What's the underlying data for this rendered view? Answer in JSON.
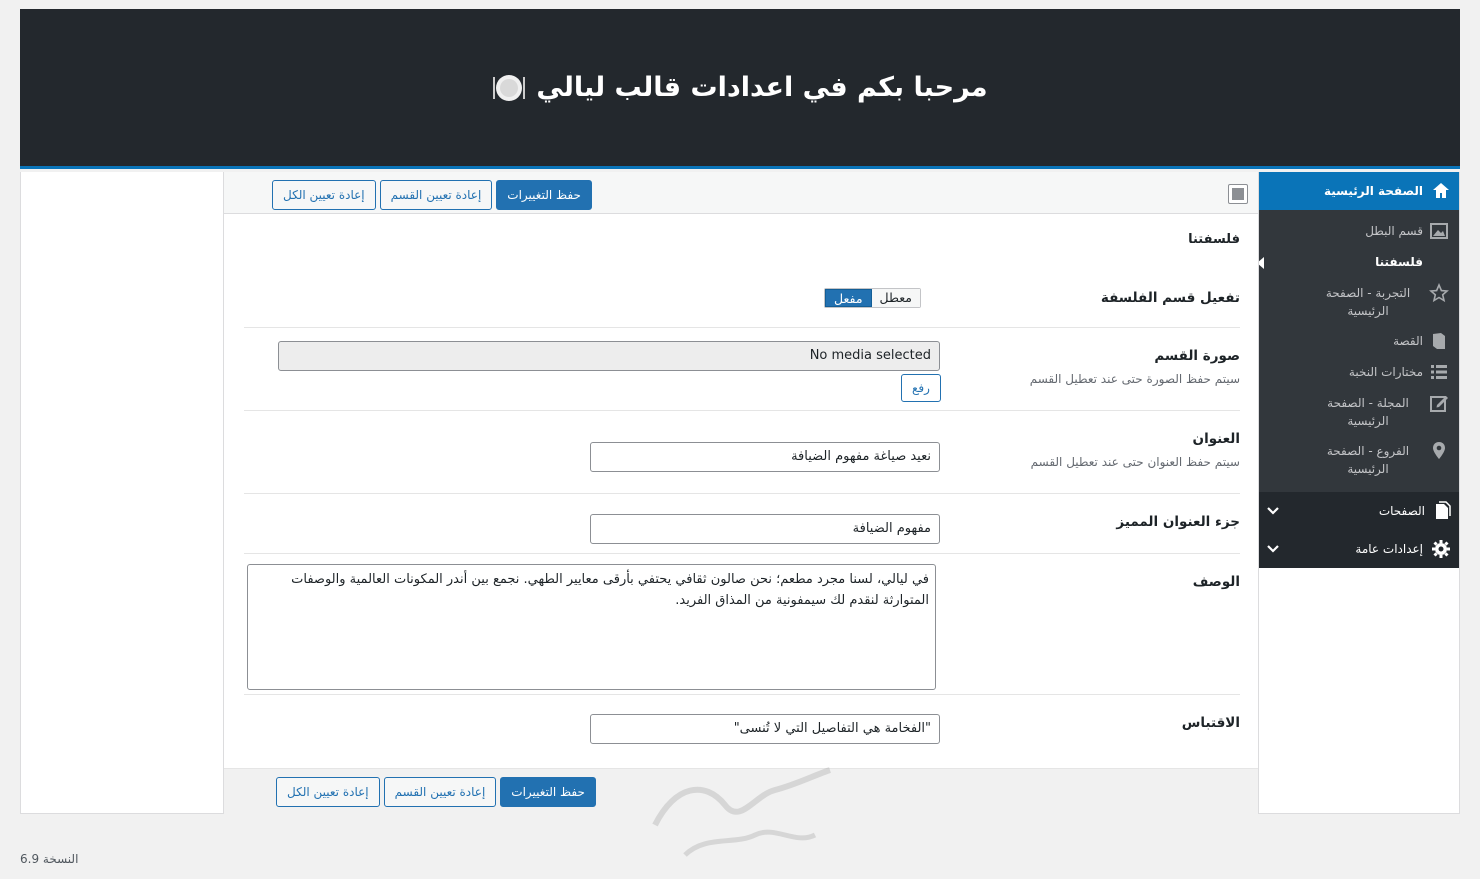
{
  "header": {
    "title": "مرحبا بكم في اعدادات قالب ليالي"
  },
  "sidebar": {
    "top_label": "الصفحة الرئيسية",
    "items": [
      {
        "label": "قسم البطل",
        "icon": "image-icon"
      },
      {
        "label": "فلسفتنا",
        "icon": "none",
        "active": true
      },
      {
        "label": "التجربة - الصفحة الرئيسية",
        "icon": "star-icon"
      },
      {
        "label": "القصة",
        "icon": "book-icon"
      },
      {
        "label": "مختارات النخبة",
        "icon": "list-icon"
      },
      {
        "label": "المجلة - الصفحة الرئيسية",
        "icon": "edit-icon"
      },
      {
        "label": "الفروع - الصفحة الرئيسية",
        "icon": "location-icon"
      }
    ],
    "groups": [
      {
        "label": "الصفحات",
        "icon": "pages-icon"
      },
      {
        "label": "إعدادات عامة",
        "icon": "gear-icon"
      }
    ]
  },
  "toolbar": {
    "save": "حفظ التغييرات",
    "reset_section": "إعادة تعيين القسم",
    "reset_all": "إعادة تعيين الكل"
  },
  "section": {
    "title": "فلسفتنا",
    "enable": {
      "label": "تفعيل قسم الفلسفة",
      "on": "مفعل",
      "off": "معطل",
      "value": "on"
    },
    "image": {
      "label": "صورة القسم",
      "hint": "سيتم حفظ الصورة حتى عند تعطيل القسم",
      "value": "No media selected",
      "upload": "رفع"
    },
    "heading": {
      "label": "العنوان",
      "hint": "سيتم حفظ العنوان حتى عند تعطيل القسم",
      "value": "نعيد صياغة مفهوم الضيافة"
    },
    "highlight": {
      "label": "جزء العنوان المميز",
      "value": "مفهوم الضيافة"
    },
    "description": {
      "label": "الوصف",
      "value": "في ليالي، لسنا مجرد مطعم؛ نحن صالون ثقافي يحتفي بأرقى معايير الطهي. نجمع بين أندر المكونات العالمية والوصفات المتوارثة لنقدم لك سيمفونية من المذاق الفريد."
    },
    "quote": {
      "label": "الاقتباس",
      "value": "\"الفخامة هي التفاصيل التي لا تُنسى\""
    }
  },
  "footer": {
    "version": "النسخة 6.9"
  },
  "colors": {
    "accent": "#2271b1",
    "header_bg": "#23282d",
    "sidebar_bg": "#32373c"
  }
}
